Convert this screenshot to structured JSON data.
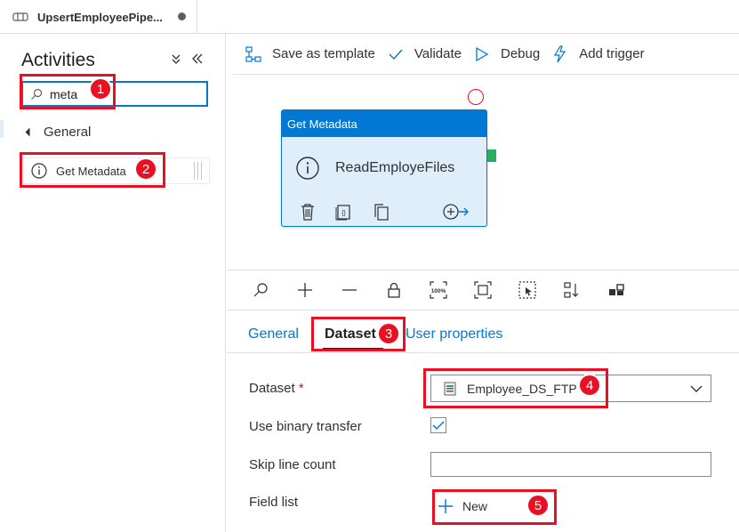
{
  "tab": {
    "title": "UpsertEmployeePipe..."
  },
  "activities_panel": {
    "title": "Activities",
    "search_value": "meta",
    "group_label": "General",
    "item_label": "Get Metadata"
  },
  "toolbar": {
    "save_template": "Save as template",
    "validate": "Validate",
    "debug": "Debug",
    "add_trigger": "Add trigger"
  },
  "canvas": {
    "card_type": "Get Metadata",
    "card_name": "ReadEmployeFiles"
  },
  "zoom_icons": [
    "search-icon",
    "zoom-in-icon",
    "zoom-out-icon",
    "lock-icon",
    "zoom-100-icon",
    "fit-screen-icon",
    "select-icon",
    "auto-align-icon",
    "layout-icon"
  ],
  "properties": {
    "tabs": [
      "General",
      "Dataset",
      "User properties"
    ],
    "active_tab": "Dataset",
    "dataset_label": "Dataset",
    "required_mark": "*",
    "dataset_value": "Employee_DS_FTP",
    "binary_label": "Use binary transfer",
    "binary_checked": true,
    "skip_label": "Skip line count",
    "skip_value": "",
    "field_list_label": "Field list",
    "new_label": "New"
  },
  "callouts": {
    "badge_1": "1",
    "badge_2": "2",
    "badge_3": "3",
    "badge_4": "4",
    "badge_5": "5"
  },
  "colors": {
    "accent": "#0078d4",
    "callout_red": "#e81123",
    "card_bg": "#deeffb",
    "port_green": "#27ae60"
  }
}
